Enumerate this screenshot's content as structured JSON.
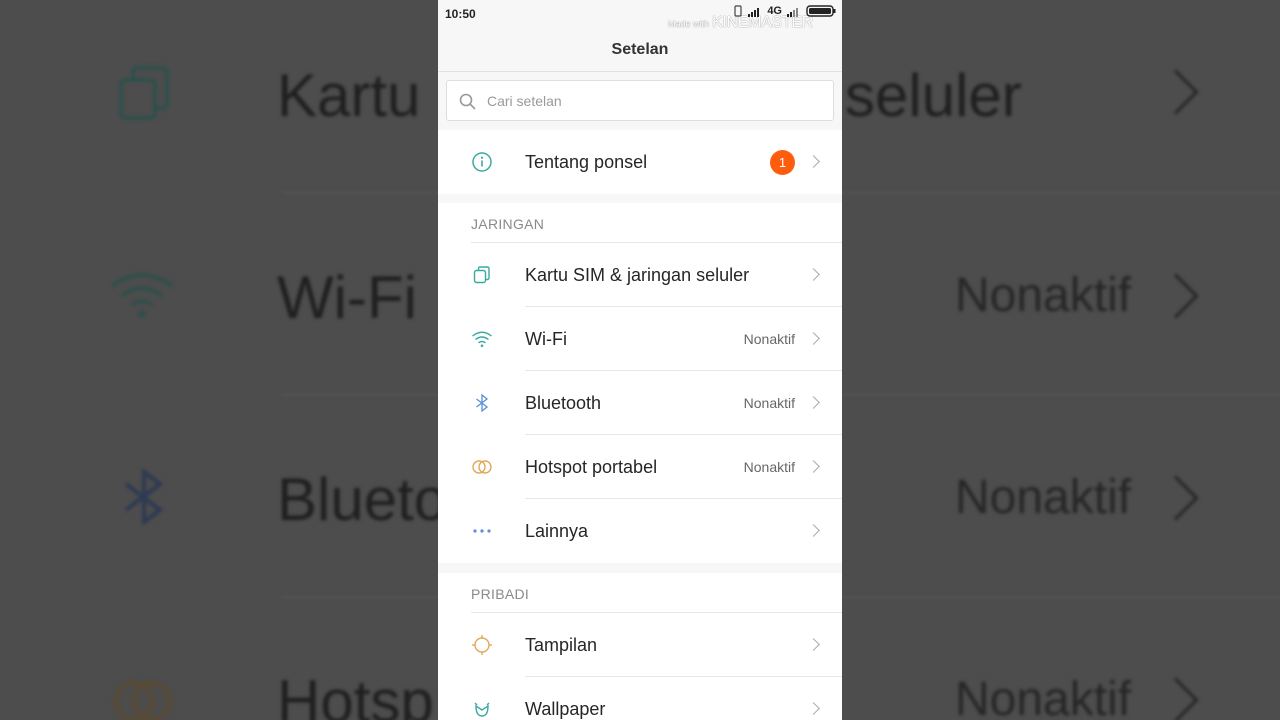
{
  "status_bar": {
    "time": "10:50",
    "network": "4G",
    "watermark_prefix": "Made with",
    "watermark_brand": "KINEMASTER"
  },
  "header": {
    "title": "Setelan"
  },
  "search": {
    "placeholder": "Cari setelan"
  },
  "about": {
    "label": "Tentang ponsel",
    "badge": "1",
    "icon": "info-icon"
  },
  "sections": {
    "network": {
      "header": "JARINGAN",
      "items": [
        {
          "label": "Kartu SIM & jaringan seluler",
          "value": "",
          "icon": "sim-card-icon"
        },
        {
          "label": "Wi-Fi",
          "value": "Nonaktif",
          "icon": "wifi-icon"
        },
        {
          "label": "Bluetooth",
          "value": "Nonaktif",
          "icon": "bluetooth-icon"
        },
        {
          "label": "Hotspot portabel",
          "value": "Nonaktif",
          "icon": "hotspot-icon"
        },
        {
          "label": "Lainnya",
          "value": "",
          "icon": "more-dots-icon"
        }
      ]
    },
    "personal": {
      "header": "PRIBADI",
      "items": [
        {
          "label": "Tampilan",
          "value": "",
          "icon": "display-icon"
        },
        {
          "label": "Wallpaper",
          "value": "",
          "icon": "wallpaper-icon"
        }
      ]
    }
  },
  "background": {
    "row1_label": "Kartu S",
    "row1_label_right": "seluler",
    "row2_label": "Wi-Fi",
    "row2_value": "Nonaktif",
    "row3_label": "Blueto",
    "row3_value": "Nonaktif",
    "row4_label": "Hotsp",
    "row4_value": "Nonaktif"
  },
  "colors": {
    "badge": "#ff5d0e",
    "icon_teal": "#3aa9a0",
    "icon_blue": "#5b8fd6",
    "icon_orange": "#e0a85a"
  }
}
